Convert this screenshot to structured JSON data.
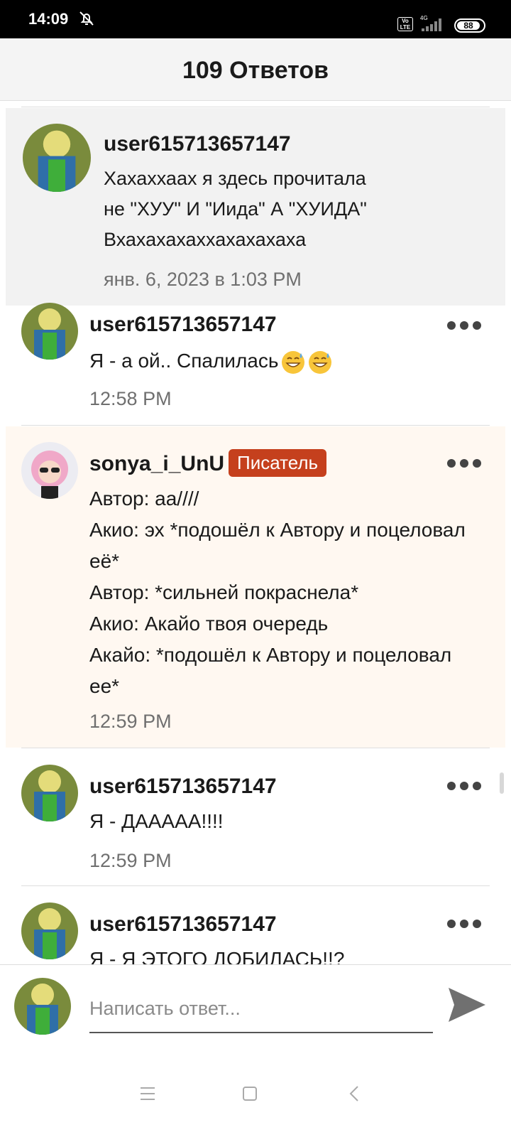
{
  "status_bar": {
    "time": "14:09",
    "volte": "Vo LTE",
    "network": "4G",
    "battery": "88"
  },
  "header": {
    "title": "109 Ответов"
  },
  "comments": [
    {
      "username": "user615713657147",
      "text": "Хахаххаах я здесь прочитала\nне \"ХУУ\" И \"Иида\" А \"ХУИДА\"\nВхахахахаххахахахаха",
      "time": "янв. 6, 2023 в 1:03 PM"
    },
    {
      "username": "user615713657147",
      "text": "Я - а ой.. Спалилась",
      "emoji": "sweat-smile-emoji",
      "time": "12:58 PM"
    },
    {
      "username": "sonya_i_UnU",
      "badge": "Писатель",
      "text": "Автор: аа////\nАкио: эх *подошёл к Автору и поцеловал\nеё*\nАвтор: *сильней покраснела*\nАкио: Акайо твоя очередь\nАкайо: *подошёл к Автору и поцеловал\nее*",
      "time": "12:59 PM"
    },
    {
      "username": "user615713657147",
      "text": "Я - ДААААА!!!!",
      "time": "12:59 PM"
    },
    {
      "username": "user615713657147",
      "text": "Я - Я ЭТОГО ДОБИЛАСЬ!!?"
    }
  ],
  "reply": {
    "placeholder": "Написать ответ..."
  },
  "icons": {
    "more": "more-dots-icon",
    "send": "send-icon",
    "menu": "menu-icon",
    "home": "home-square-icon",
    "back": "back-chevron-icon"
  },
  "colors": {
    "badge": "#c5401d",
    "writer_highlight": "#fff8f1",
    "parent_highlight": "#f2f2f2"
  }
}
